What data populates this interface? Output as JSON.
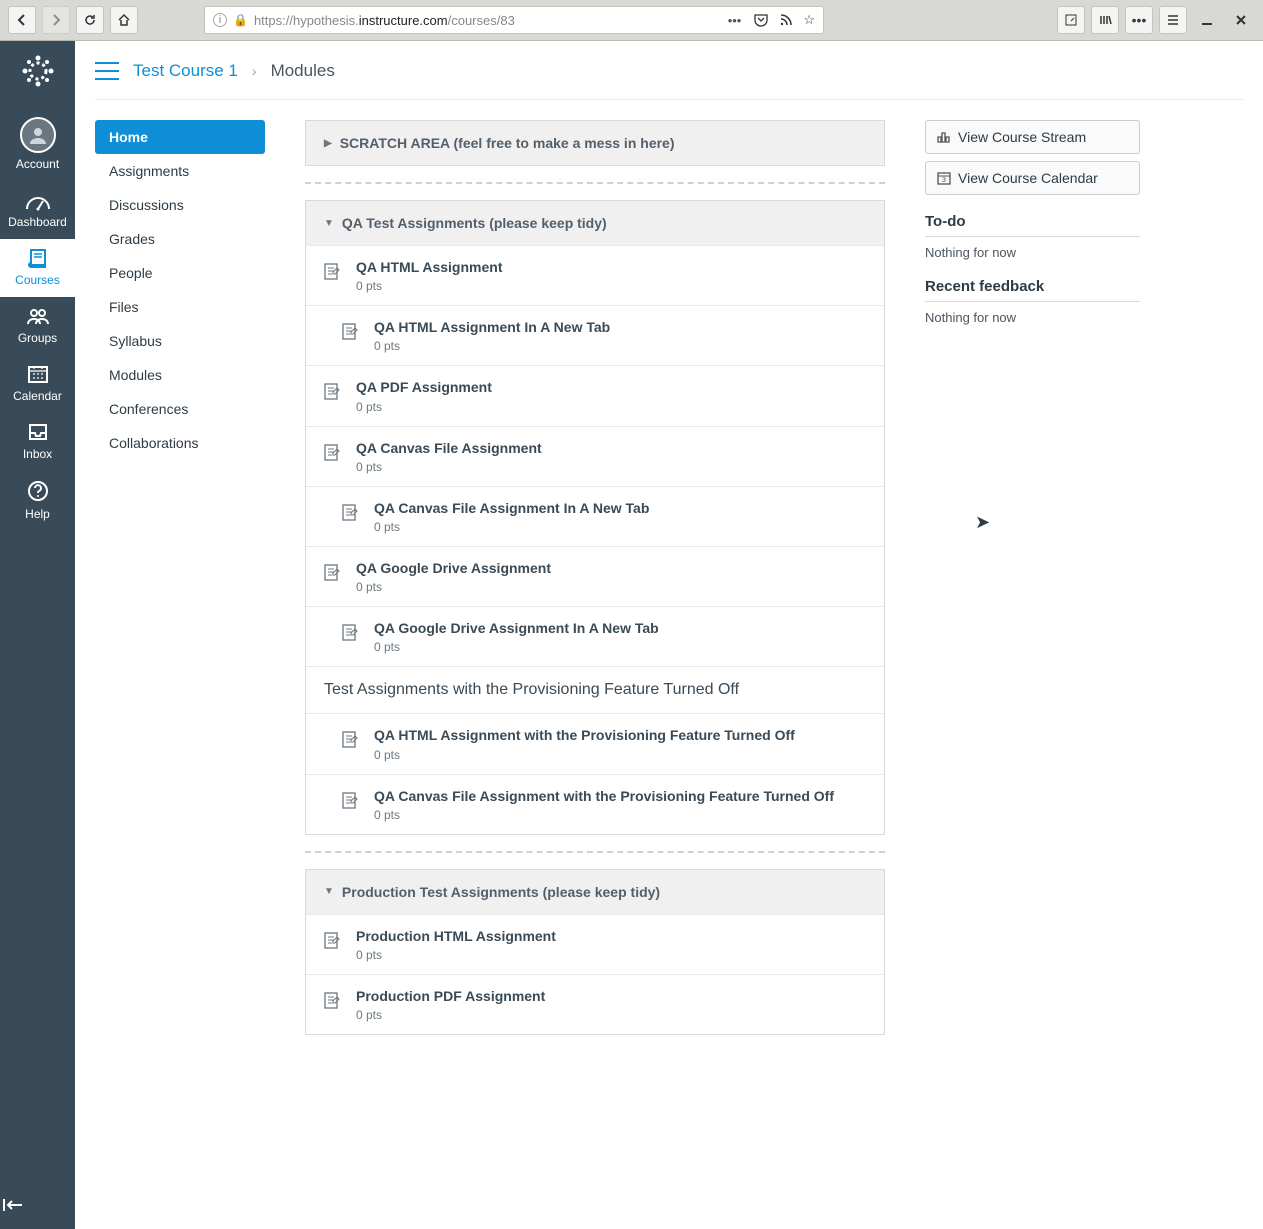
{
  "url": {
    "prefix": "https://hypothesis.",
    "host": "instructure.com",
    "path": "/courses/83"
  },
  "global_nav": {
    "account": "Account",
    "dashboard": "Dashboard",
    "courses": "Courses",
    "groups": "Groups",
    "calendar": "Calendar",
    "inbox": "Inbox",
    "help": "Help"
  },
  "breadcrumb": {
    "course": "Test Course 1",
    "page": "Modules"
  },
  "course_nav": [
    "Home",
    "Assignments",
    "Discussions",
    "Grades",
    "People",
    "Files",
    "Syllabus",
    "Modules",
    "Conferences",
    "Collaborations"
  ],
  "modules": [
    {
      "title": "SCRATCH AREA (feel free to make a mess in here)",
      "expanded": false,
      "items": []
    },
    {
      "title": "QA Test Assignments (please keep tidy)",
      "expanded": true,
      "items": [
        {
          "type": "assignment",
          "indent": false,
          "title": "QA HTML Assignment",
          "pts": "0 pts"
        },
        {
          "type": "assignment",
          "indent": true,
          "title": "QA HTML Assignment In A New Tab",
          "pts": "0 pts"
        },
        {
          "type": "assignment",
          "indent": false,
          "title": "QA PDF Assignment",
          "pts": "0 pts"
        },
        {
          "type": "assignment",
          "indent": false,
          "title": "QA Canvas File Assignment",
          "pts": "0 pts"
        },
        {
          "type": "assignment",
          "indent": true,
          "title": "QA Canvas File Assignment In A New Tab",
          "pts": "0 pts"
        },
        {
          "type": "assignment",
          "indent": false,
          "title": "QA Google Drive Assignment",
          "pts": "0 pts"
        },
        {
          "type": "assignment",
          "indent": true,
          "title": "QA Google Drive Assignment In A New Tab",
          "pts": "0 pts"
        },
        {
          "type": "subheader",
          "title": "Test Assignments with the Provisioning Feature Turned Off"
        },
        {
          "type": "assignment",
          "indent": true,
          "title": "QA HTML Assignment with the Provisioning Feature Turned Off",
          "pts": "0 pts"
        },
        {
          "type": "assignment",
          "indent": true,
          "title": "QA Canvas File Assignment with the Provisioning Feature Turned Off",
          "pts": "0 pts"
        }
      ]
    },
    {
      "title": "Production Test Assignments (please keep tidy)",
      "expanded": true,
      "items": [
        {
          "type": "assignment",
          "indent": false,
          "title": "Production HTML Assignment",
          "pts": "0 pts"
        },
        {
          "type": "assignment",
          "indent": false,
          "title": "Production PDF Assignment",
          "pts": "0 pts"
        }
      ]
    }
  ],
  "sidebar": {
    "stream_btn": "View Course Stream",
    "calendar_btn": "View Course Calendar",
    "todo_h": "To-do",
    "todo_empty": "Nothing for now",
    "feedback_h": "Recent feedback",
    "feedback_empty": "Nothing for now"
  }
}
